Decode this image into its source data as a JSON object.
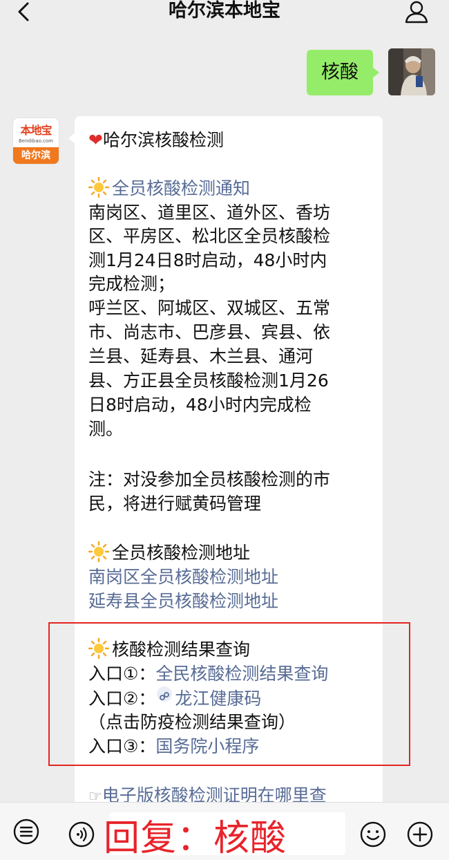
{
  "header": {
    "title": "哈尔滨本地宝"
  },
  "outgoing": {
    "text": "核酸"
  },
  "bot_avatar": {
    "logo_main": "本地宝",
    "logo_url": "Bendibao.com",
    "logo_city": "哈尔滨"
  },
  "message": {
    "title": "哈尔滨核酸检测",
    "sec1_link": "全员核酸检测通知",
    "sec1_lines": [
      "南岗区、道里区、道外区、香坊",
      "区、平房区、松北区全员核酸检",
      "测1月24日8时启动，48小时内",
      "完成检测；",
      "呼兰区、阿城区、双城区、五常",
      "市、尚志市、巴彦县、宾县、依",
      "兰县、延寿县、木兰县、通河",
      "县、方正县全员核酸检测1月26",
      "日8时启动，48小时内完成检",
      "测。"
    ],
    "note_lines": [
      "注：对没参加全员核酸检测的市",
      "民，将进行赋黄码管理"
    ],
    "sec2_title": "全员核酸检测地址",
    "sec2_links": [
      "南岗区全员核酸检测地址",
      "延寿县全员核酸检测地址"
    ],
    "sec3_title": "核酸检测结果查询",
    "entry1_prefix": "入口①：",
    "entry1_link": "全民核酸检测结果查询",
    "entry2_prefix": "入口②：",
    "entry2_link": "龙江健康码",
    "entry2_note": "（点击防疫检测结果查询）",
    "entry3_prefix": "入口③：",
    "entry3_link": "国务院小程序",
    "cut_line": "电子版核酸检测证明在哪里查"
  },
  "overlay": {
    "text": "回复：核酸"
  },
  "colors": {
    "link": "#576b95",
    "bubble_green": "#95ec69",
    "highlight_red": "#e52222",
    "overlay_red": "#e8232a"
  }
}
